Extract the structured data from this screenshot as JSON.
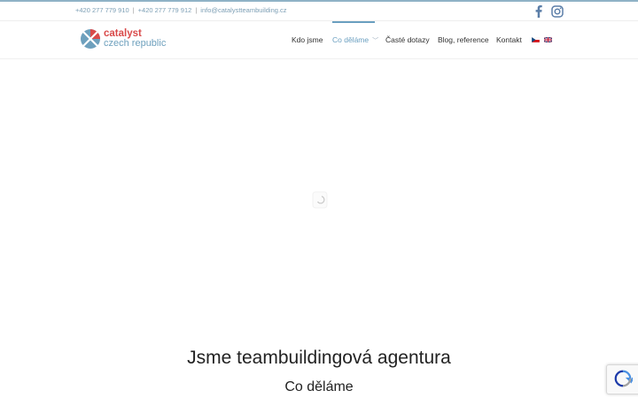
{
  "topbar": {
    "phone1": "+420 277 779 910",
    "phone2": "+420 277 779 912",
    "email": "info@catalystteambuilding.cz",
    "separator": "|"
  },
  "social": [
    {
      "icon": "facebook-icon"
    },
    {
      "icon": "instagram-icon"
    }
  ],
  "logo": {
    "line1": "catalyst",
    "line2": "czech republic"
  },
  "nav": {
    "items": [
      {
        "label": "Kdo jsme"
      },
      {
        "label": "Co děláme",
        "active": true
      },
      {
        "label": "Časté dotazy"
      },
      {
        "label": "Blog, reference"
      },
      {
        "label": "Kontakt"
      }
    ],
    "languages": [
      "cz-flag-icon",
      "uk-flag-icon"
    ]
  },
  "main": {
    "heading": "Jsme teambuildingová agentura",
    "subheading": "Co děláme"
  },
  "colors": {
    "accent": "#6a9fc0",
    "logo_red": "#d94a4a",
    "text": "#333333"
  }
}
